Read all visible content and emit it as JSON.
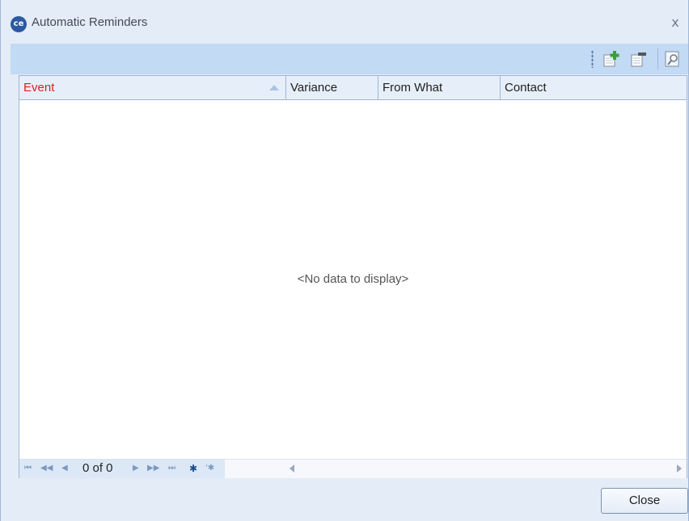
{
  "window": {
    "title": "Automatic Reminders",
    "logo_text": "ce",
    "close_glyph": "x"
  },
  "toolbar": {
    "icons": [
      "add-row-icon",
      "delete-row-icon",
      "preview-icon"
    ]
  },
  "grid": {
    "columns": [
      "Event",
      "Variance",
      "From What",
      "Contact"
    ],
    "sort_column": "Event",
    "empty_message": "<No data to display>"
  },
  "navigator": {
    "page_text": "0 of 0",
    "first": "⏮",
    "prev_page": "◀◀",
    "prev": "◀",
    "next": "▶",
    "next_page": "▶▶",
    "last": "⏭",
    "append": "✱",
    "edit": "'✱"
  },
  "footer": {
    "close_label": "Close"
  },
  "colors": {
    "sorted_header": "#e31b23",
    "toolbar_bg": "#c2daf3",
    "window_bg": "#e4ecf7"
  }
}
